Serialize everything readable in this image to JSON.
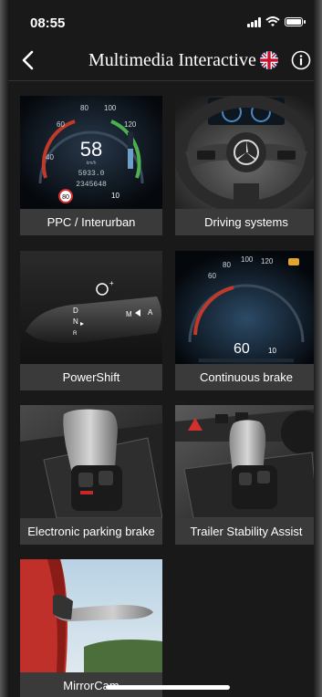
{
  "status_bar": {
    "time": "08:55",
    "icons": [
      "signal-icon",
      "wifi-icon",
      "battery-icon"
    ]
  },
  "header": {
    "title": "Multimedia Interactive",
    "back_icon": "chevron-left-icon",
    "language_icon": "uk-flag-icon",
    "info_icon": "info-icon"
  },
  "tiles": [
    {
      "label": "PPC / Interurban",
      "image": {
        "speed": "58",
        "unit": "km/h",
        "odo": "5933.0",
        "total": "2345648",
        "limit": "80",
        "small": "10"
      }
    },
    {
      "label": "Driving systems"
    },
    {
      "label": "PowerShift",
      "image": {
        "modes": [
          "D",
          "N",
          "R",
          "M",
          "A"
        ]
      }
    },
    {
      "label": "Continuous brake",
      "image": {
        "speed": "60",
        "small": "10",
        "ticks": [
          "60",
          "80",
          "100",
          "120"
        ]
      }
    },
    {
      "label": "Electronic parking brake"
    },
    {
      "label": "Trailer Stability Assist"
    },
    {
      "label": "MirrorCam"
    }
  ],
  "colors": {
    "background": "#191919",
    "tile_label_bg": "#3a3a3a",
    "text": "#ffffff"
  }
}
